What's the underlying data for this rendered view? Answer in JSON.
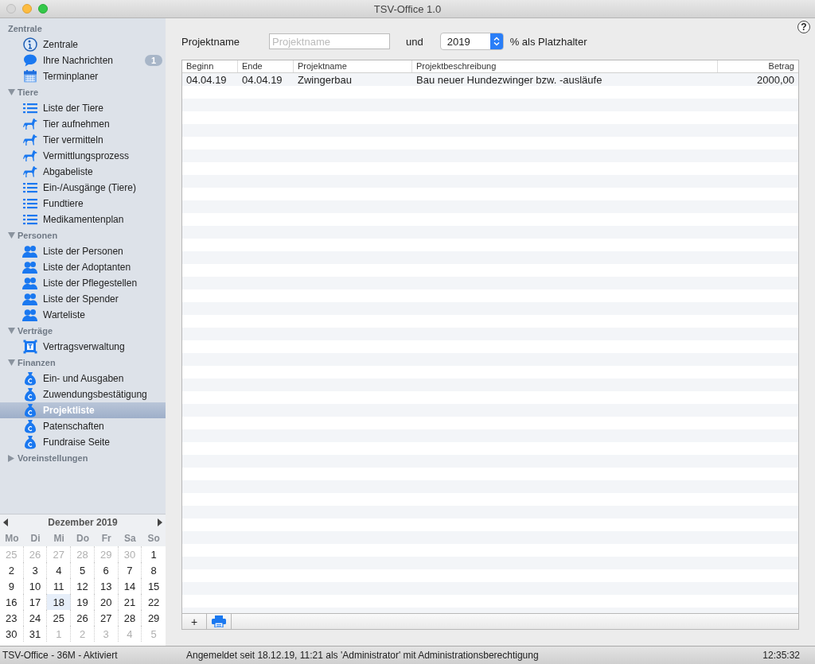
{
  "window": {
    "title": "TSV-Office 1.0"
  },
  "help_button": "?",
  "sidebar": {
    "top": {
      "label": "Zentrale",
      "items": [
        {
          "label": "Zentrale",
          "kind": "info",
          "selected": false
        },
        {
          "label": "Ihre Nachrichten",
          "kind": "chat",
          "selected": false,
          "badge": "1"
        },
        {
          "label": "Terminplaner",
          "kind": "calendar",
          "selected": false
        }
      ]
    },
    "groups": [
      {
        "label": "Tiere",
        "expanded": true,
        "items": [
          {
            "label": "Liste der Tiere",
            "kind": "list",
            "selected": false
          },
          {
            "label": "Tier aufnehmen",
            "kind": "dog",
            "selected": false
          },
          {
            "label": "Tier vermitteln",
            "kind": "dog",
            "selected": false
          },
          {
            "label": "Vermittlungsprozess",
            "kind": "dog",
            "selected": false
          },
          {
            "label": "Abgabeliste",
            "kind": "dog",
            "selected": false
          },
          {
            "label": "Ein-/Ausgänge (Tiere)",
            "kind": "list",
            "selected": false
          },
          {
            "label": "Fundtiere",
            "kind": "list",
            "selected": false
          },
          {
            "label": "Medikamentenplan",
            "kind": "list",
            "selected": false
          }
        ]
      },
      {
        "label": "Personen",
        "expanded": true,
        "items": [
          {
            "label": "Liste der Personen",
            "kind": "people",
            "selected": false
          },
          {
            "label": "Liste der Adoptanten",
            "kind": "people",
            "selected": false
          },
          {
            "label": "Liste der Pflegestellen",
            "kind": "people",
            "selected": false
          },
          {
            "label": "Liste der Spender",
            "kind": "people",
            "selected": false
          },
          {
            "label": "Warteliste",
            "kind": "people",
            "selected": false
          }
        ]
      },
      {
        "label": "Verträge",
        "expanded": true,
        "items": [
          {
            "label": "Vertragsverwaltung",
            "kind": "contract",
            "selected": false
          }
        ]
      },
      {
        "label": "Finanzen",
        "expanded": true,
        "items": [
          {
            "label": "Ein- und Ausgaben",
            "kind": "moneybag",
            "selected": false
          },
          {
            "label": "Zuwendungsbestätigung",
            "kind": "moneybag",
            "selected": false
          },
          {
            "label": "Projektliste",
            "kind": "moneybag",
            "selected": true
          },
          {
            "label": "Patenschaften",
            "kind": "moneybag",
            "selected": false
          },
          {
            "label": "Fundraise Seite",
            "kind": "moneybag",
            "selected": false
          }
        ]
      },
      {
        "label": "Voreinstellungen",
        "expanded": false
      }
    ]
  },
  "calendar": {
    "month": "Dezember 2019",
    "weekdays": [
      "Mo",
      "Di",
      "Mi",
      "Do",
      "Fr",
      "Sa",
      "So"
    ],
    "weeks": [
      [
        {
          "day": "25",
          "other_month": true,
          "selected": false
        },
        {
          "day": "26",
          "other_month": true,
          "selected": false
        },
        {
          "day": "27",
          "other_month": true,
          "selected": false
        },
        {
          "day": "28",
          "other_month": true,
          "selected": false
        },
        {
          "day": "29",
          "other_month": true,
          "selected": false
        },
        {
          "day": "30",
          "other_month": true,
          "selected": false
        },
        {
          "day": "1",
          "other_month": false,
          "selected": false
        }
      ],
      [
        {
          "day": "2",
          "other_month": false,
          "selected": false
        },
        {
          "day": "3",
          "other_month": false,
          "selected": false
        },
        {
          "day": "4",
          "other_month": false,
          "selected": false
        },
        {
          "day": "5",
          "other_month": false,
          "selected": false
        },
        {
          "day": "6",
          "other_month": false,
          "selected": false
        },
        {
          "day": "7",
          "other_month": false,
          "selected": false
        },
        {
          "day": "8",
          "other_month": false,
          "selected": false
        }
      ],
      [
        {
          "day": "9",
          "other_month": false,
          "selected": false
        },
        {
          "day": "10",
          "other_month": false,
          "selected": false
        },
        {
          "day": "11",
          "other_month": false,
          "selected": false
        },
        {
          "day": "12",
          "other_month": false,
          "selected": false
        },
        {
          "day": "13",
          "other_month": false,
          "selected": false
        },
        {
          "day": "14",
          "other_month": false,
          "selected": false
        },
        {
          "day": "15",
          "other_month": false,
          "selected": false
        }
      ],
      [
        {
          "day": "16",
          "other_month": false,
          "selected": false
        },
        {
          "day": "17",
          "other_month": false,
          "selected": false
        },
        {
          "day": "18",
          "other_month": false,
          "selected": true
        },
        {
          "day": "19",
          "other_month": false,
          "selected": false
        },
        {
          "day": "20",
          "other_month": false,
          "selected": false
        },
        {
          "day": "21",
          "other_month": false,
          "selected": false
        },
        {
          "day": "22",
          "other_month": false,
          "selected": false
        }
      ],
      [
        {
          "day": "23",
          "other_month": false,
          "selected": false
        },
        {
          "day": "24",
          "other_month": false,
          "selected": false
        },
        {
          "day": "25",
          "other_month": false,
          "selected": false
        },
        {
          "day": "26",
          "other_month": false,
          "selected": false
        },
        {
          "day": "27",
          "other_month": false,
          "selected": false
        },
        {
          "day": "28",
          "other_month": false,
          "selected": false
        },
        {
          "day": "29",
          "other_month": false,
          "selected": false
        }
      ],
      [
        {
          "day": "30",
          "other_month": false,
          "selected": false
        },
        {
          "day": "31",
          "other_month": false,
          "selected": false
        },
        {
          "day": "1",
          "other_month": true,
          "selected": false
        },
        {
          "day": "2",
          "other_month": true,
          "selected": false
        },
        {
          "day": "3",
          "other_month": true,
          "selected": false
        },
        {
          "day": "4",
          "other_month": true,
          "selected": false
        },
        {
          "day": "5",
          "other_month": true,
          "selected": false
        }
      ]
    ]
  },
  "filter": {
    "name_label": "Projektname",
    "name_placeholder": "Projektname",
    "and_label": "und",
    "year": "2019",
    "hint": "% als Platzhalter"
  },
  "table": {
    "columns": [
      {
        "label": "Beginn",
        "kind": "text"
      },
      {
        "label": "Ende",
        "kind": "text"
      },
      {
        "label": "Projektname",
        "kind": "text"
      },
      {
        "label": "Projektbeschreibung",
        "kind": "text"
      },
      {
        "label": "Betrag",
        "kind": "amount"
      }
    ],
    "rows": [
      [
        "04.04.19",
        "04.04.19",
        "Zwingerbau",
        "Bau neuer Hundezwinger bzw. -ausläufe",
        "2000,00"
      ]
    ],
    "add_button": "+"
  },
  "status_bar": {
    "app": "TSV-Office - 36M - Aktiviert",
    "session": "Angemeldet seit 18.12.19, 11:21 als 'Administrator' mit Administrationsberechtigung",
    "time": "12:35:32"
  }
}
